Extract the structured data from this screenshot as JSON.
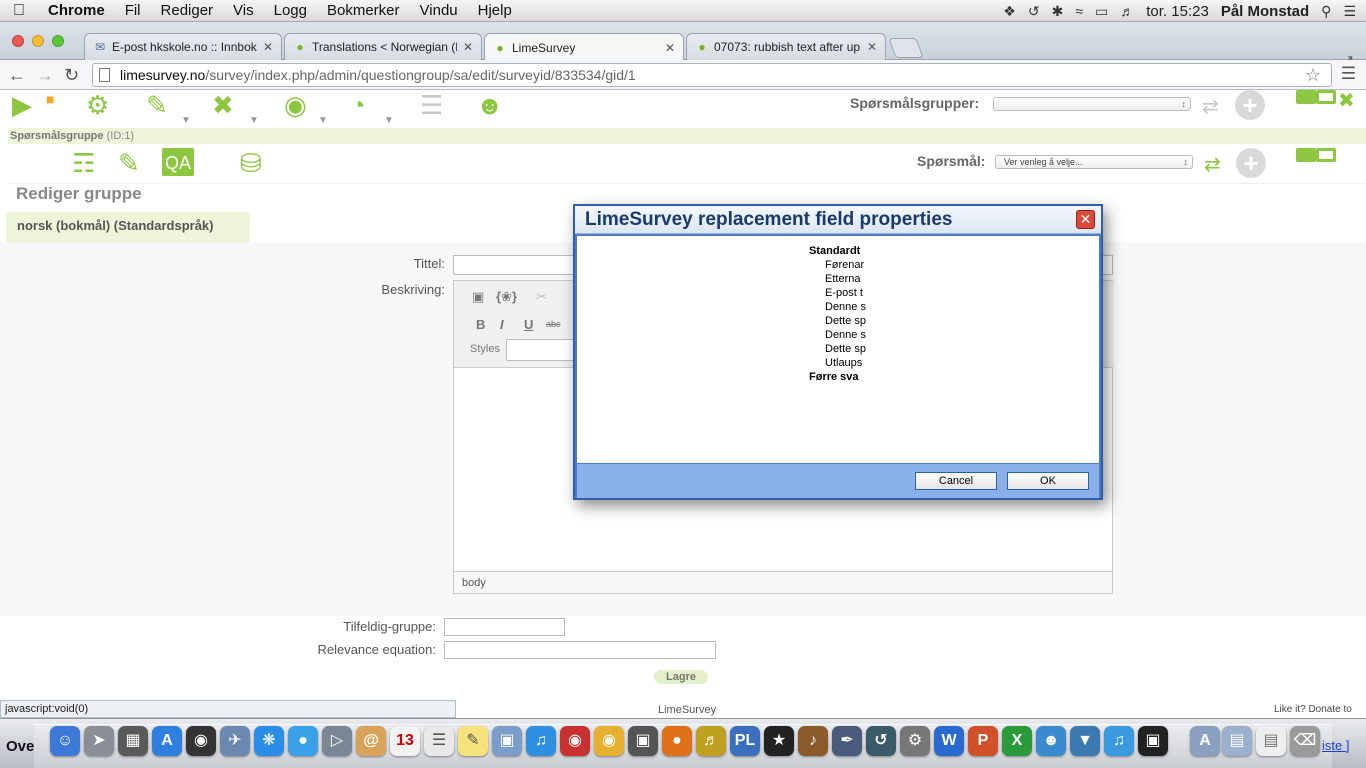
{
  "menubar": {
    "app": "Chrome",
    "items": [
      "Fil",
      "Rediger",
      "Vis",
      "Logg",
      "Bokmerker",
      "Vindu",
      "Hjelp"
    ],
    "clock": "tor. 15:23",
    "user": "Pål Monstad"
  },
  "tabs": [
    {
      "title": "E-post hkskole.no :: Innboks"
    },
    {
      "title": "Translations < Norwegian (N"
    },
    {
      "title": "LimeSurvey"
    },
    {
      "title": "07073: rubbish text after up"
    }
  ],
  "address": {
    "host": "limesurvey.no",
    "path": "/survey/index.php/admin/questiongroup/sa/edit/surveyid/833534/gid/1"
  },
  "toolbar": {
    "question_groups_label": "Spørsmålsgrupper:",
    "question_group_title": "Spørsmålsgruppe",
    "question_group_id": "(ID:1)",
    "questions_label": "Spørsmål:",
    "questions_select": "Ver venleg å velje..."
  },
  "page": {
    "title": "Rediger gruppe",
    "language_tab": "norsk (bokmål) (Standardspråk)",
    "title_label": "Tittel:",
    "description_label": "Beskriving:",
    "styles_label": "Styles",
    "editor_path": "body",
    "random_group_label": "Tilfeldig-gruppe:",
    "relevance_label": "Relevance equation:",
    "save_button": "Lagre"
  },
  "status": {
    "url": "javascript:void(0)",
    "footer": "LimeSurvey",
    "donate": "Like it? Donate to"
  },
  "dialog": {
    "title": "LimeSurvey replacement field properties",
    "groups": [
      {
        "label": "Standardt",
        "options": [
          "Førenar",
          "Etterna",
          "E-post t",
          "Denne s",
          "Dette sp",
          "Denne s",
          "Dette sp",
          "Utlaups"
        ]
      },
      {
        "label": "Førre sva",
        "options": []
      }
    ],
    "cancel": "Cancel",
    "ok": "OK"
  },
  "dock": {
    "left_text": "Ove",
    "right_text": "iste ]"
  }
}
